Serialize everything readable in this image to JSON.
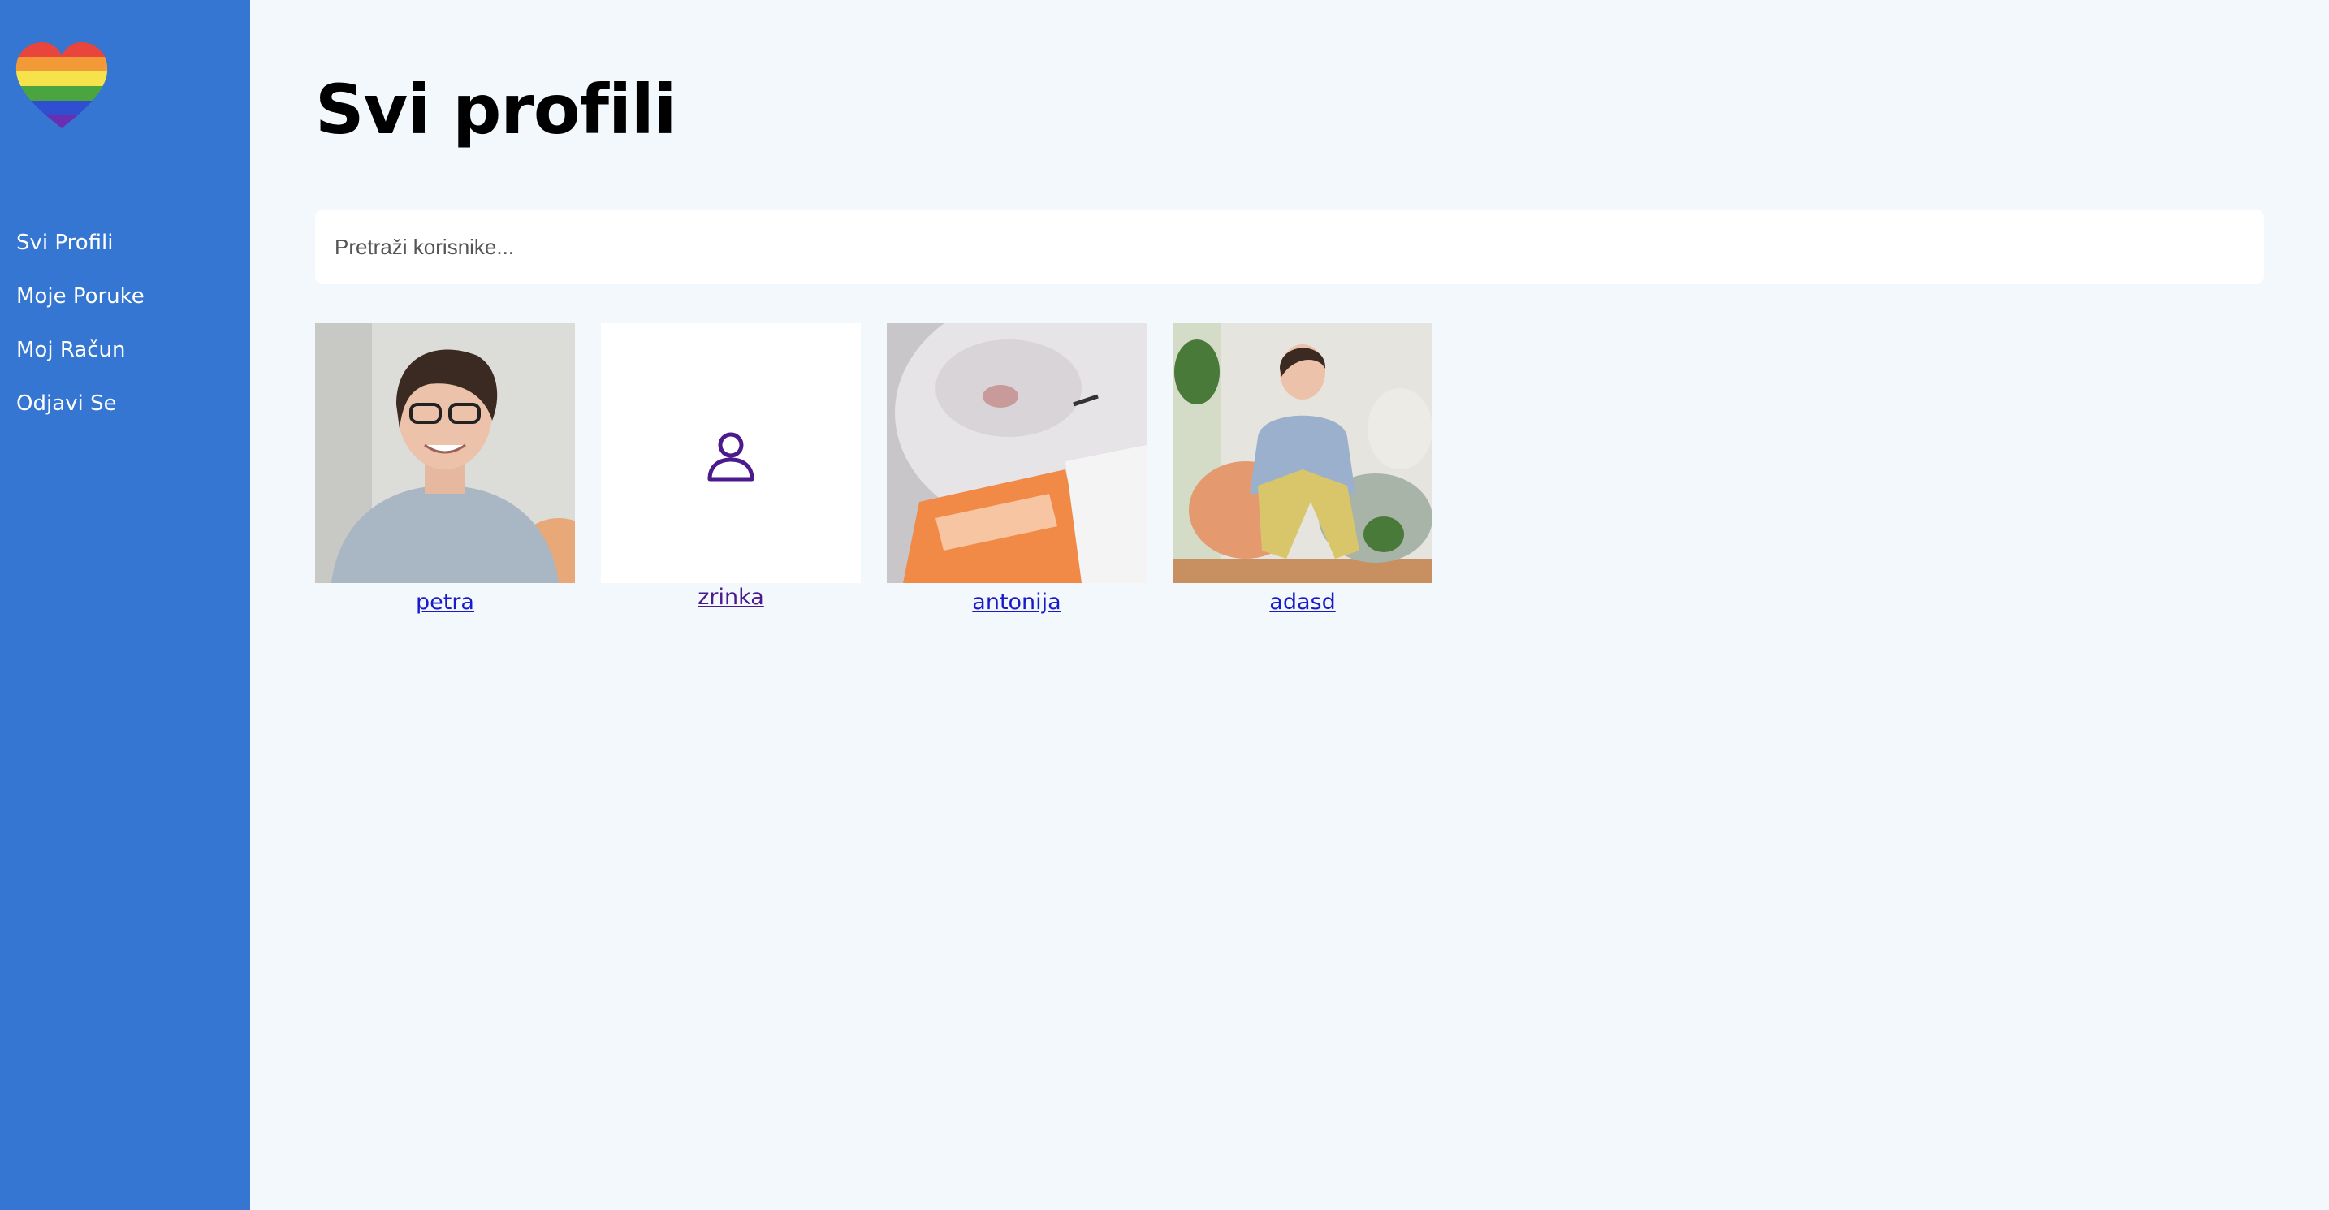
{
  "sidebar": {
    "logo_icon": "rainbow-heart-icon",
    "items": [
      {
        "label": "Svi Profili"
      },
      {
        "label": "Moje Poruke"
      },
      {
        "label": "Moj Račun"
      },
      {
        "label": "Odjavi Se"
      }
    ]
  },
  "main": {
    "title": "Svi profili",
    "search": {
      "placeholder": "Pretraži korisnike...",
      "value": ""
    },
    "profiles": [
      {
        "name": "petra",
        "photo": "person-photo"
      },
      {
        "name": "zrinka",
        "photo": "default-user-icon"
      },
      {
        "name": "antonija",
        "photo": "cat-photo"
      },
      {
        "name": "adasd",
        "photo": "person-sitting-photo"
      }
    ]
  },
  "colors": {
    "sidebar": "#3476d1",
    "background": "#f2f8fc",
    "link": "#1a1acc",
    "visited_link": "#4b1a8c"
  }
}
